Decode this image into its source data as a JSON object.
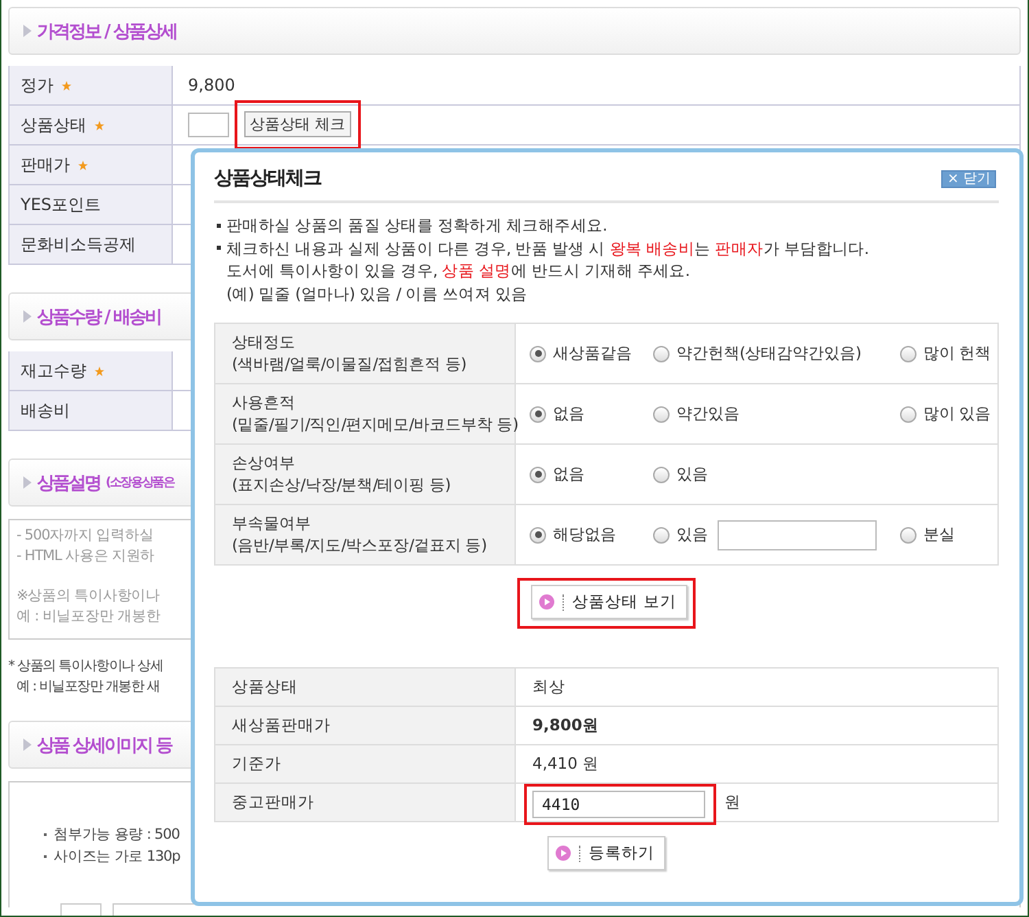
{
  "sections": [
    {
      "kind": "table",
      "title": "가격정보 / 상품상세",
      "rows": [
        {
          "kind": "text",
          "label": "정가",
          "required": true,
          "value": "9,800"
        },
        {
          "kind": "check",
          "label": "상품상태",
          "required": true,
          "button": {
            "label": "상품상태 체크",
            "highlighted": true
          }
        },
        {
          "kind": "empty",
          "label": "판매가",
          "required": true
        },
        {
          "kind": "empty",
          "label": "YES포인트",
          "required": false
        },
        {
          "kind": "empty",
          "label": "문화비소득공제",
          "required": false
        }
      ]
    },
    {
      "kind": "table",
      "title": "상품수량 / 배송비",
      "rows": [
        {
          "kind": "empty",
          "label": "재고수량",
          "required": true
        },
        {
          "kind": "empty",
          "label": "배송비",
          "required": false
        }
      ]
    },
    {
      "kind": "description",
      "title": "상품설명",
      "subtitle": "(소장용상품은",
      "box_paragraphs": [
        [
          "- 500자까지 입력하실",
          "- HTML 사용은 지원하"
        ],
        [
          "※상품의 특이사항이나",
          "예 : 비닐포장만 개봉한"
        ]
      ],
      "notes": [
        "* 상품의 특이사항이나 상세",
        "예 : 비닐포장만 개봉한 새"
      ]
    },
    {
      "kind": "upload",
      "title": "상품 상세이미지 등",
      "bullets": [
        "첨부가능 용량 : 500",
        "사이즈는 가로 130p"
      ]
    }
  ],
  "popup": {
    "title": "상품상태체크",
    "close": "× 닫기",
    "notes": [
      {
        "bullet": true,
        "text": "판매하실 상품의 품질 상태를 정확하게 체크해주세요."
      },
      {
        "bullet": true,
        "text": "체크하신 내용과 실제 상품이 다른 경우, 반품 발생 시 **왕복 배송비**는 **판매자**가 부담합니다."
      },
      {
        "bullet": false,
        "text": "도서에 특이사항이 있을 경우, **상품 설명**에 반드시 기재해 주세요."
      },
      {
        "bullet": false,
        "text": "(예) 밑줄 (얼마나) 있음 / 이름 쓰여져 있음"
      }
    ],
    "conditions": [
      {
        "label": "상태정도",
        "hint": "(색바램/얼룩/이물질/접힘흔적 등)",
        "options": [
          {
            "kind": "radio",
            "label": "새상품같음",
            "selected": true
          },
          {
            "kind": "radio",
            "label": "약간헌책(상태감약간있음)",
            "selected": false
          },
          {
            "kind": "radio",
            "label": "많이 헌책",
            "selected": false
          }
        ]
      },
      {
        "label": "사용흔적",
        "hint": "(밑줄/필기/직인/편지메모/바코드부착 등)",
        "options": [
          {
            "kind": "radio",
            "label": "없음",
            "selected": true
          },
          {
            "kind": "radio",
            "label": "약간있음",
            "selected": false
          },
          {
            "kind": "radio",
            "label": "많이 있음",
            "selected": false
          }
        ]
      },
      {
        "label": "손상여부",
        "hint": "(표지손상/낙장/분책/테이핑 등)",
        "options": [
          {
            "kind": "radio",
            "label": "없음",
            "selected": true
          },
          {
            "kind": "radio",
            "label": "있음",
            "selected": false
          }
        ]
      },
      {
        "label": "부속물여부",
        "hint": "(음반/부록/지도/박스포장/겉표지 등)",
        "options": [
          {
            "kind": "radio",
            "label": "해당없음",
            "selected": true
          },
          {
            "kind": "radio_field",
            "label": "있음",
            "selected": false
          },
          {
            "kind": "radio",
            "label": "분실",
            "selected": false
          }
        ]
      }
    ],
    "check_button": {
      "label": "상품상태 보기",
      "highlighted": true
    },
    "summary": [
      {
        "kind": "text",
        "label": "상품상태",
        "value": "최상"
      },
      {
        "kind": "bold",
        "label": "새상품판매가",
        "value": "9,800원"
      },
      {
        "kind": "text",
        "label": "기준가",
        "value": "4,410 원"
      },
      {
        "kind": "input",
        "label": "중고판매가",
        "value": "4410",
        "unit": "원",
        "highlighted": true
      }
    ],
    "submit_button": {
      "label": "등록하기",
      "highlighted": false
    }
  }
}
